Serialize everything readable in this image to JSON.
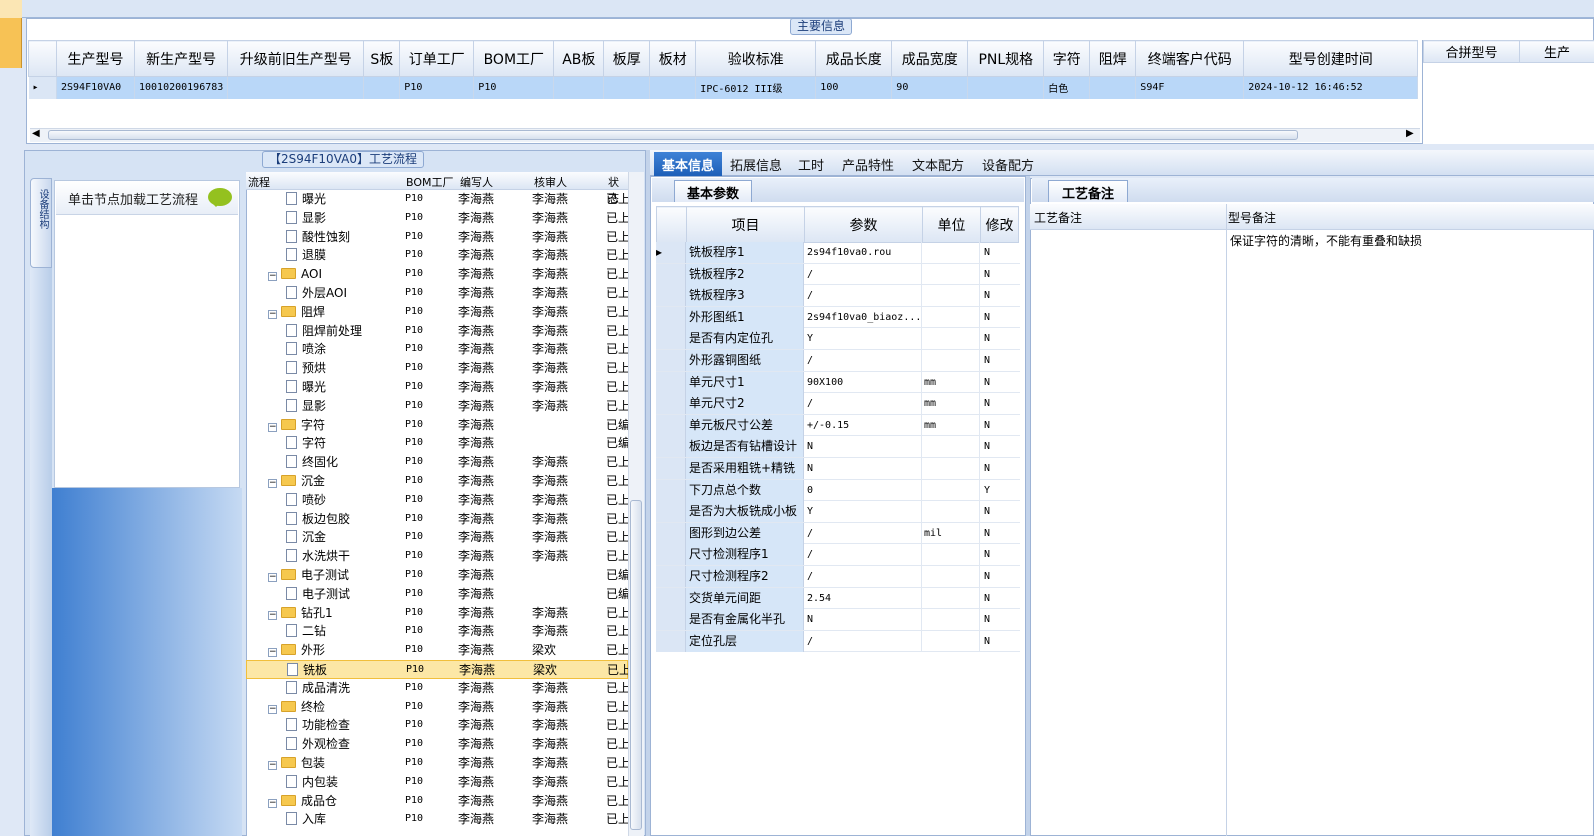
{
  "main_info": {
    "caption": "主要信息",
    "columns": [
      "生产型号",
      "新生产型号",
      "升级前旧生产型号",
      "S板",
      "订单工厂",
      "BOM工厂",
      "AB板",
      "板厚",
      "板材",
      "验收标准",
      "成品长度",
      "成品宽度",
      "PNL规格",
      "字符",
      "阻焊",
      "终端客户代码",
      "型号创建时间"
    ],
    "row": [
      "2S94F10VA0",
      "10010200196783",
      "",
      "",
      "P10",
      "P10",
      "",
      "",
      "",
      "IPC-6012 III级",
      "100",
      "90",
      "",
      "白色",
      "",
      "S94F",
      "2024-10-12 16:46:52"
    ],
    "extra_columns": [
      "合拼型号",
      "生产"
    ]
  },
  "process_flow": {
    "caption": "【2S94F10VA0】工艺流程",
    "side_tab": "设备结构",
    "hint": "单击节点加载工艺流程",
    "headers": [
      "流程",
      "BOM工厂",
      "编写人",
      "核审人",
      "状态"
    ],
    "rows": [
      {
        "name": "曝光",
        "level": 2,
        "type": "file",
        "bom": "P10",
        "writer": "李海燕",
        "reviewer": "李海燕",
        "status": "已上"
      },
      {
        "name": "显影",
        "level": 2,
        "type": "file",
        "bom": "P10",
        "writer": "李海燕",
        "reviewer": "李海燕",
        "status": "已上"
      },
      {
        "name": "酸性蚀刻",
        "level": 2,
        "type": "file",
        "bom": "P10",
        "writer": "李海燕",
        "reviewer": "李海燕",
        "status": "已上"
      },
      {
        "name": "退膜",
        "level": 2,
        "type": "file",
        "bom": "P10",
        "writer": "李海燕",
        "reviewer": "李海燕",
        "status": "已上"
      },
      {
        "name": "AOI",
        "level": 1,
        "type": "folder",
        "bom": "P10",
        "writer": "李海燕",
        "reviewer": "李海燕",
        "status": "已上"
      },
      {
        "name": "外层AOI",
        "level": 2,
        "type": "file",
        "bom": "P10",
        "writer": "李海燕",
        "reviewer": "李海燕",
        "status": "已上"
      },
      {
        "name": "阻焊",
        "level": 1,
        "type": "folder",
        "bom": "P10",
        "writer": "李海燕",
        "reviewer": "李海燕",
        "status": "已上"
      },
      {
        "name": "阻焊前处理",
        "level": 2,
        "type": "file",
        "bom": "P10",
        "writer": "李海燕",
        "reviewer": "李海燕",
        "status": "已上"
      },
      {
        "name": "喷涂",
        "level": 2,
        "type": "file",
        "bom": "P10",
        "writer": "李海燕",
        "reviewer": "李海燕",
        "status": "已上"
      },
      {
        "name": "预烘",
        "level": 2,
        "type": "file",
        "bom": "P10",
        "writer": "李海燕",
        "reviewer": "李海燕",
        "status": "已上"
      },
      {
        "name": "曝光",
        "level": 2,
        "type": "file",
        "bom": "P10",
        "writer": "李海燕",
        "reviewer": "李海燕",
        "status": "已上"
      },
      {
        "name": "显影",
        "level": 2,
        "type": "file",
        "bom": "P10",
        "writer": "李海燕",
        "reviewer": "李海燕",
        "status": "已上"
      },
      {
        "name": "字符",
        "level": 1,
        "type": "folder",
        "bom": "P10",
        "writer": "李海燕",
        "reviewer": "",
        "status": "已编"
      },
      {
        "name": "字符",
        "level": 2,
        "type": "file",
        "bom": "P10",
        "writer": "李海燕",
        "reviewer": "",
        "status": "已编"
      },
      {
        "name": "终固化",
        "level": 2,
        "type": "file",
        "bom": "P10",
        "writer": "李海燕",
        "reviewer": "李海燕",
        "status": "已上"
      },
      {
        "name": "沉金",
        "level": 1,
        "type": "folder",
        "bom": "P10",
        "writer": "李海燕",
        "reviewer": "李海燕",
        "status": "已上"
      },
      {
        "name": "喷砂",
        "level": 2,
        "type": "file",
        "bom": "P10",
        "writer": "李海燕",
        "reviewer": "李海燕",
        "status": "已上"
      },
      {
        "name": "板边包胶",
        "level": 2,
        "type": "file",
        "bom": "P10",
        "writer": "李海燕",
        "reviewer": "李海燕",
        "status": "已上"
      },
      {
        "name": "沉金",
        "level": 2,
        "type": "file",
        "bom": "P10",
        "writer": "李海燕",
        "reviewer": "李海燕",
        "status": "已上"
      },
      {
        "name": "水洗烘干",
        "level": 2,
        "type": "file",
        "bom": "P10",
        "writer": "李海燕",
        "reviewer": "李海燕",
        "status": "已上"
      },
      {
        "name": "电子测试",
        "level": 1,
        "type": "folder",
        "bom": "P10",
        "writer": "李海燕",
        "reviewer": "",
        "status": "已编"
      },
      {
        "name": "电子测试",
        "level": 2,
        "type": "file",
        "bom": "P10",
        "writer": "李海燕",
        "reviewer": "",
        "status": "已编"
      },
      {
        "name": "钻孔1",
        "level": 1,
        "type": "folder",
        "bom": "P10",
        "writer": "李海燕",
        "reviewer": "李海燕",
        "status": "已上"
      },
      {
        "name": "二钻",
        "level": 2,
        "type": "file",
        "bom": "P10",
        "writer": "李海燕",
        "reviewer": "李海燕",
        "status": "已上"
      },
      {
        "name": "外形",
        "level": 1,
        "type": "folder",
        "bom": "P10",
        "writer": "李海燕",
        "reviewer": "梁欢",
        "status": "已上"
      },
      {
        "name": "铣板",
        "level": 2,
        "type": "file",
        "bom": "P10",
        "writer": "李海燕",
        "reviewer": "梁欢",
        "status": "已上",
        "selected": true
      },
      {
        "name": "成品清洗",
        "level": 2,
        "type": "file",
        "bom": "P10",
        "writer": "李海燕",
        "reviewer": "李海燕",
        "status": "已上"
      },
      {
        "name": "终检",
        "level": 1,
        "type": "folder",
        "bom": "P10",
        "writer": "李海燕",
        "reviewer": "李海燕",
        "status": "已上"
      },
      {
        "name": "功能检查",
        "level": 2,
        "type": "file",
        "bom": "P10",
        "writer": "李海燕",
        "reviewer": "李海燕",
        "status": "已上"
      },
      {
        "name": "外观检查",
        "level": 2,
        "type": "file",
        "bom": "P10",
        "writer": "李海燕",
        "reviewer": "李海燕",
        "status": "已上"
      },
      {
        "name": "包装",
        "level": 1,
        "type": "folder",
        "bom": "P10",
        "writer": "李海燕",
        "reviewer": "李海燕",
        "status": "已上"
      },
      {
        "name": "内包装",
        "level": 2,
        "type": "file",
        "bom": "P10",
        "writer": "李海燕",
        "reviewer": "李海燕",
        "status": "已上"
      },
      {
        "name": "成品仓",
        "level": 1,
        "type": "folder",
        "bom": "P10",
        "writer": "李海燕",
        "reviewer": "李海燕",
        "status": "已上"
      },
      {
        "name": "入库",
        "level": 2,
        "type": "file",
        "bom": "P10",
        "writer": "李海燕",
        "reviewer": "李海燕",
        "status": "已上"
      }
    ]
  },
  "tabs": [
    "基本信息",
    "拓展信息",
    "工时",
    "产品特性",
    "文本配方",
    "设备配方"
  ],
  "basic_params": {
    "subtab": "基本参数",
    "headers": [
      "项目",
      "参数",
      "单位",
      "修改"
    ],
    "rows": [
      {
        "item": "铣板程序1",
        "value": "2s94f10va0.rou",
        "unit": "",
        "mod": "N"
      },
      {
        "item": "铣板程序2",
        "value": "/",
        "unit": "",
        "mod": "N"
      },
      {
        "item": "铣板程序3",
        "value": "/",
        "unit": "",
        "mod": "N"
      },
      {
        "item": "外形图纸1",
        "value": "2s94f10va0_biaoz...",
        "unit": "",
        "mod": "N"
      },
      {
        "item": "是否有内定位孔",
        "value": "Y",
        "unit": "",
        "mod": "N"
      },
      {
        "item": "外形露铜图纸",
        "value": "/",
        "unit": "",
        "mod": "N"
      },
      {
        "item": "单元尺寸1",
        "value": "90X100",
        "unit": "mm",
        "mod": "N"
      },
      {
        "item": "单元尺寸2",
        "value": "/",
        "unit": "mm",
        "mod": "N"
      },
      {
        "item": "单元板尺寸公差",
        "value": "+/-0.15",
        "unit": "mm",
        "mod": "N"
      },
      {
        "item": "板边是否有钻槽设计",
        "value": "N",
        "unit": "",
        "mod": "N"
      },
      {
        "item": "是否采用粗铣+精铣",
        "value": "N",
        "unit": "",
        "mod": "N"
      },
      {
        "item": "下刀点总个数",
        "value": "0",
        "unit": "",
        "mod": "Y"
      },
      {
        "item": "是否为大板铣成小板",
        "value": "Y",
        "unit": "",
        "mod": "N"
      },
      {
        "item": "图形到边公差",
        "value": "/",
        "unit": "mil",
        "mod": "N"
      },
      {
        "item": "尺寸检测程序1",
        "value": "/",
        "unit": "",
        "mod": "N"
      },
      {
        "item": "尺寸检测程序2",
        "value": "/",
        "unit": "",
        "mod": "N"
      },
      {
        "item": "交货单元间距",
        "value": "2.54",
        "unit": "",
        "mod": "N"
      },
      {
        "item": "是否有金属化半孔",
        "value": "N",
        "unit": "",
        "mod": "N"
      },
      {
        "item": "定位孔层",
        "value": "/",
        "unit": "",
        "mod": "N"
      }
    ]
  },
  "process_notes": {
    "subtab": "工艺备注",
    "col1": "工艺备注",
    "col2": "型号备注",
    "model_note": "保证字符的清晰，不能有重叠和缺损"
  }
}
